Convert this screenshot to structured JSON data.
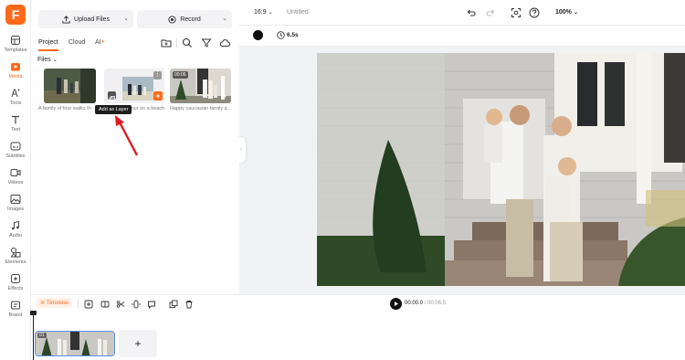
{
  "brand": {
    "logo_letter": "F",
    "accent": "#ff6a1a"
  },
  "rail": {
    "items": [
      {
        "label": "Templates",
        "icon": "templates-icon"
      },
      {
        "label": "Media",
        "icon": "media-icon",
        "active": true
      },
      {
        "label": "Tools",
        "icon": "ai-tools-icon"
      },
      {
        "label": "Text",
        "icon": "text-icon"
      },
      {
        "label": "Subtitles",
        "icon": "subtitles-icon"
      },
      {
        "label": "Videos",
        "icon": "videos-icon"
      },
      {
        "label": "Images",
        "icon": "images-icon"
      },
      {
        "label": "Audio",
        "icon": "audio-icon"
      },
      {
        "label": "Elements",
        "icon": "elements-icon"
      },
      {
        "label": "Effects",
        "icon": "effects-icon"
      },
      {
        "label": "Brand",
        "icon": "brand-icon"
      }
    ]
  },
  "panel": {
    "upload_label": "Upload Files",
    "record_label": "Record",
    "tabs": [
      "Project",
      "Cloud",
      "AI"
    ],
    "files_label": "Files",
    "files": [
      {
        "caption": "A family of four walks th"
      },
      {
        "caption": "four on a beach"
      },
      {
        "caption": "Happy caucasian family a...",
        "duration": "00:06"
      }
    ],
    "tooltip": "Add as Layer"
  },
  "topbar": {
    "aspect": "16:9",
    "title": "Untitled",
    "zoom": "100%"
  },
  "subbar": {
    "duration": "6.5s"
  },
  "timeline": {
    "label": "Timeline",
    "current_time": "00:00.0",
    "separator": "/",
    "total_time": "00:06.5",
    "clip_badge": "01",
    "add_label": "+"
  }
}
